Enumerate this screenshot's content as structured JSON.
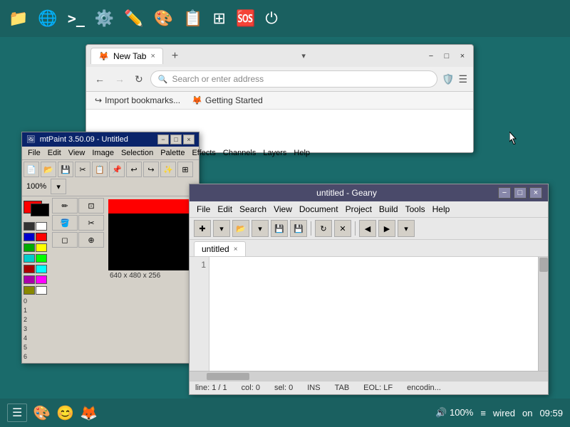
{
  "taskbar_top": {
    "icons": [
      "folder",
      "globe",
      "terminal",
      "settings",
      "edit",
      "brush",
      "copy",
      "grid",
      "help",
      "power"
    ]
  },
  "firefox": {
    "tab_label": "New Tab",
    "tab_close": "×",
    "tab_new": "+",
    "address_placeholder": "Search or enter address",
    "address_icon": "🔍",
    "bookmark1": "Import bookmarks...",
    "bookmark2": "Getting Started",
    "win_min": "−",
    "win_max": "□",
    "win_close": "×"
  },
  "mtpaint": {
    "title": "mtPaint 3.50.09 - Untitled",
    "menu_items": [
      "File",
      "Edit",
      "View",
      "Image",
      "Selection",
      "Palette",
      "Effects",
      "Channels",
      "Layers",
      "Help"
    ],
    "size_label": "640 x 480 x 256",
    "win_min": "−",
    "win_max": "□",
    "win_close": "×"
  },
  "geany": {
    "title": "untitled - Geany",
    "menu_items": [
      "File",
      "Edit",
      "Search",
      "View",
      "Document",
      "Project",
      "Build",
      "Tools",
      "Help"
    ],
    "tab_label": "untitled",
    "tab_close": "×",
    "line_number": "1",
    "status_line": "line: 1 / 1",
    "status_col": "col: 0",
    "status_sel": "sel: 0",
    "status_ins": "INS",
    "status_tab": "TAB",
    "status_eol": "EOL: LF",
    "status_enc": "encodin...",
    "win_min": "−",
    "win_max": "□",
    "win_close": "×"
  },
  "taskbar_bottom": {
    "time": "09:59",
    "volume": "🔊 100%",
    "network": "wired",
    "network_status": "on"
  },
  "palette_colors": [
    [
      "#000000",
      "#ffffff"
    ],
    [
      "#0000aa",
      "#ff0000"
    ],
    [
      "#00aa00",
      "#ffff00"
    ],
    [
      "#00aaaa",
      "#00ff00"
    ],
    [
      "#aa0000",
      "#00ffff"
    ],
    [
      "#aa00aa",
      "#ff00ff"
    ],
    [
      "#aa5500",
      "#ffffff"
    ],
    [
      "#aaaaaa",
      "#aaaaaa"
    ]
  ]
}
